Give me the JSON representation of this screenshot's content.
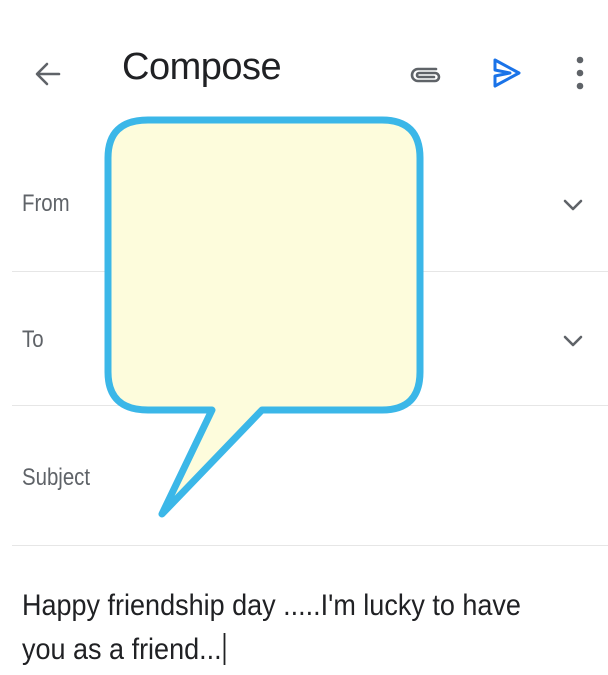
{
  "header": {
    "title": "Compose",
    "icons": {
      "back": "arrow-left-icon",
      "attach": "paperclip-icon",
      "send": "send-icon",
      "more": "more-vert-icon"
    }
  },
  "fields": {
    "from_label": "From",
    "to_label": "To",
    "subject_label": "Subject"
  },
  "body": {
    "text": "Happy friendship day .....I'm lucky to have you as a friend..."
  },
  "colors": {
    "send_blue": "#1a73e8",
    "bubble_fill": "#fdfcdc",
    "bubble_stroke": "#3bb7e8",
    "divider": "#e6e6e6"
  }
}
